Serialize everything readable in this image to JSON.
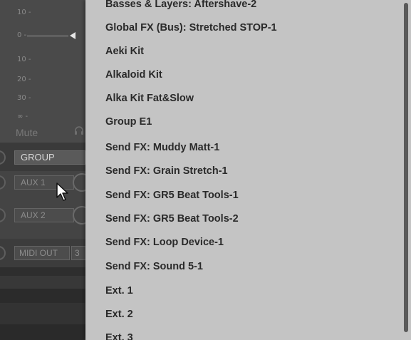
{
  "mixer": {
    "meter_ticks": [
      "10 -",
      "0 -",
      "10 -",
      "20 -",
      "30 -",
      "∞ -"
    ],
    "mute_label": "Mute",
    "group_label": "GROUP",
    "aux1_label": "AUX 1",
    "aux2_label": "AUX 2",
    "midi_out_label": "MIDI OUT",
    "midi_out_number": "3"
  },
  "menu": {
    "items": [
      "Basses & Layers: Aftershave-2",
      "Global FX (Bus): Stretched STOP-1",
      "Aeki Kit",
      "Alkaloid Kit",
      "Alka Kit Fat&Slow",
      "Group E1",
      "Send FX: Muddy Matt-1",
      "Send FX: Grain Stretch-1",
      "Send FX: GR5 Beat Tools-1",
      "Send FX: GR5 Beat Tools-2",
      "Send FX: Loop Device-1",
      "Send FX: Sound 5-1",
      "Ext. 1",
      "Ext. 2",
      "Ext. 3"
    ]
  }
}
